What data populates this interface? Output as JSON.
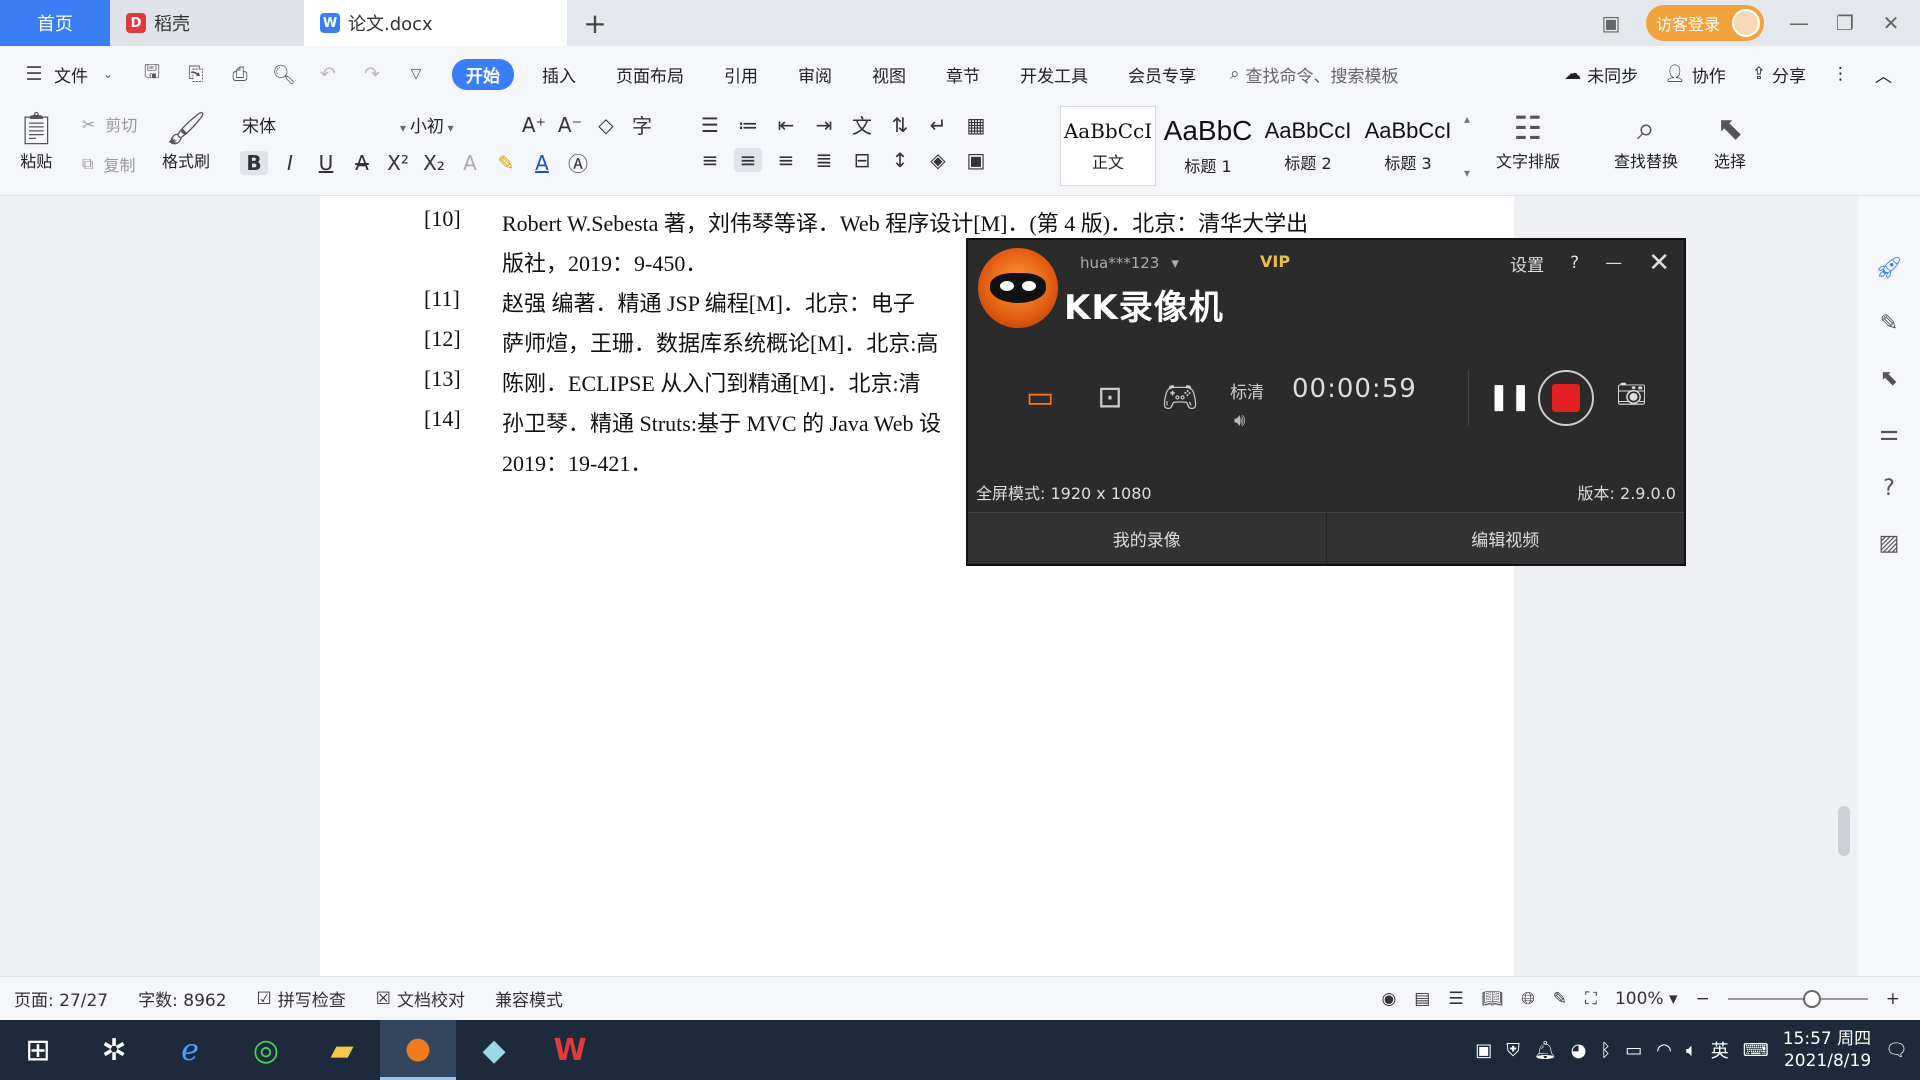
{
  "tabs": {
    "home": "首页",
    "daoke": "稻壳",
    "doc": "论文.docx",
    "new_tab": "+"
  },
  "tabbar_right": {
    "login": "访客登录"
  },
  "menu": {
    "file": "文件",
    "items": [
      "开始",
      "插入",
      "页面布局",
      "引用",
      "审阅",
      "视图",
      "章节",
      "开发工具",
      "会员专享"
    ],
    "search": "查找命令、搜索模板",
    "sync": "未同步",
    "collab": "协作",
    "share": "分享"
  },
  "ribbon": {
    "paste": "粘贴",
    "cut": "剪切",
    "copy": "复制",
    "format_painter": "格式刷",
    "font_name": "宋体",
    "font_size": "小初",
    "styles": [
      {
        "sample": "AaBbCcI",
        "name": "正文"
      },
      {
        "sample": "AaBbC",
        "name": "标题 1"
      },
      {
        "sample": "AaBbCcI",
        "name": "标题 2"
      },
      {
        "sample": "AaBbCcI",
        "name": "标题 3"
      }
    ],
    "text_layout": "文字排版",
    "find_replace": "查找替换",
    "select": "选择"
  },
  "document": {
    "refs": [
      {
        "num": "[10]",
        "text": "Robert W.Sebesta 著，刘伟琴等译．Web 程序设计[M]．(第 4 版)．北京：清华大学出",
        "cont": "版社，2019：9-450．"
      },
      {
        "num": "[11]",
        "text": "赵强  编著．精通 JSP 编程[M]．北京：电子"
      },
      {
        "num": "[12]",
        "text": "萨师煊，王珊．数据库系统概论[M]．北京:高"
      },
      {
        "num": "[13]",
        "text": "陈刚．ECLIPSE  从入门到精通[M]．北京:清"
      },
      {
        "num": "[14]",
        "text": " 孙卫琴．精通 Struts:基于 MVC 的 Java Web 设",
        "cont": "2019：19-421．"
      }
    ]
  },
  "statusbar": {
    "page": "页面: 27/27",
    "words": "字数: 8962",
    "spellcheck": "拼写检查",
    "proofread": "文档校对",
    "compat": "兼容模式",
    "zoom": "100%",
    "zoom_level": 0.6
  },
  "kk": {
    "user": "hua***123",
    "vip": "VIP",
    "settings": "设置",
    "help": "?",
    "title": "KK录像机",
    "quality": "标清",
    "timer": "00:00:59",
    "fullscreen": "全屏模式: 1920 x 1080",
    "version": "版本: 2.9.0.0",
    "my_recordings": "我的录像",
    "edit_video": "编辑视频"
  },
  "taskbar": {
    "ime": "英",
    "time": "15:57 周四",
    "date": "2021/8/19"
  }
}
